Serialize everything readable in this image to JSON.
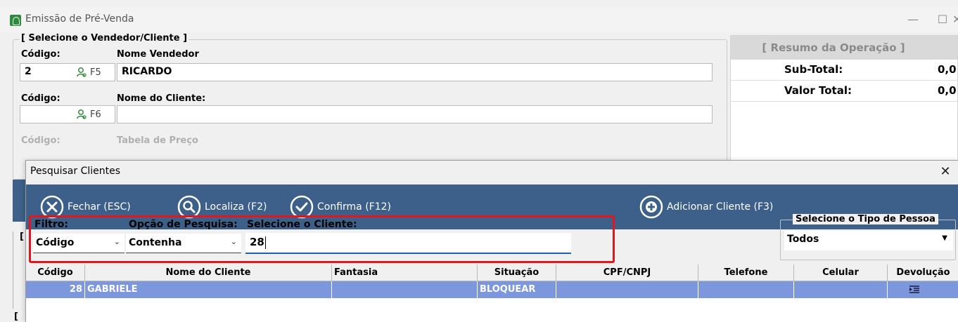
{
  "window": {
    "title": "Emissão de Pré-Venda",
    "min_glyph": "—",
    "max_glyph": "☐",
    "close_glyph": "✕"
  },
  "vendor_group": {
    "legend": "[ Selecione o Vendedor/Cliente ]",
    "codigo_label_1": "Código:",
    "nome_vendedor_label": "Nome Vendedor",
    "vendor_code": "2",
    "vendor_fkey": "F5",
    "vendor_name": "RICARDO",
    "codigo_label_2": "Código:",
    "nome_cliente_label": "Nome do Cliente:",
    "client_code": "",
    "client_fkey": "F6",
    "client_name": "",
    "codigo_label_3": "Código:",
    "tabela_preco_label": "Tabela de Preço"
  },
  "summary": {
    "header": "[ Resumo da Operação ]",
    "subtotal_label": "Sub-Total:",
    "subtotal_value": "0,0",
    "total_label": "Valor Total:",
    "total_value": "0,0"
  },
  "side_fragment": {
    "bracket_1": "[",
    "bracket_2": "[",
    "bracket_3": "[",
    "bracket_4": "["
  },
  "dialog": {
    "title": "Pesquisar Clientes",
    "close_glyph": "✕",
    "toolbar": {
      "fechar": "Fechar (ESC)",
      "localiza": "Localiza (F2)",
      "confirma": "Confirma (F12)",
      "adicionar": "Adicionar Cliente (F3)"
    },
    "filter": {
      "filtro_label": "Filtro:",
      "filtro_value": "Código",
      "opcao_label": "Opção de Pesquisa:",
      "opcao_value": "Contenha",
      "cliente_label": "Selecione o Cliente:",
      "cliente_value": "28",
      "tipo_pessoa_legend": "Selecione o Tipo de Pessoa",
      "tipo_pessoa_value": "Todos"
    },
    "grid": {
      "columns": [
        "Código",
        "Nome do Cliente",
        "Fantasia",
        "Situação",
        "CPF/CNPJ",
        "Telefone",
        "Celular",
        "Devolução"
      ],
      "rows": [
        {
          "codigo": "28",
          "nome": "GABRIELE",
          "fantasia": "",
          "situacao": "BLOQUEAR",
          "cpf": "",
          "telefone": "",
          "celular": "",
          "devolucao_icon": "list-icon"
        }
      ]
    }
  },
  "colors": {
    "toolbar": "#3c6089",
    "selected_row": "#7d97dd",
    "highlight_box": "#e3161d",
    "input_focus": "#1f5fb0"
  }
}
